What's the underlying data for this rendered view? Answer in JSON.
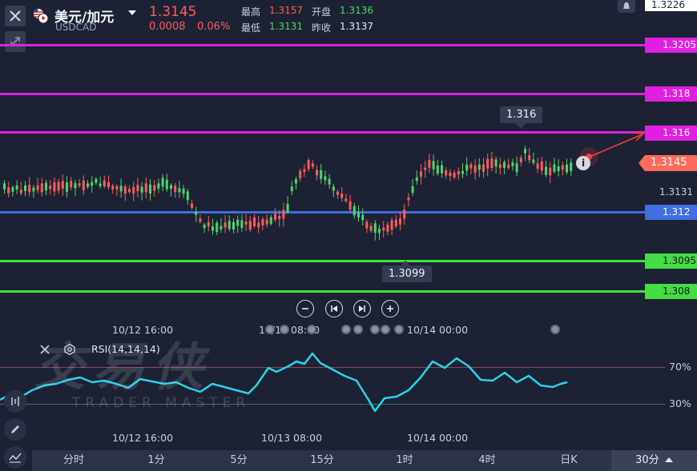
{
  "header": {
    "pair_title": "美元/加元",
    "symbol": "USDCAD",
    "last_price": "1.3145",
    "change": "0.0008",
    "change_pct": "0.06%",
    "stats": [
      {
        "label": "最高",
        "value": "1.3157",
        "color": "red"
      },
      {
        "label": "开盘",
        "value": "1.3136",
        "color": "green"
      },
      {
        "label": "最低",
        "value": "1.3131",
        "color": "green"
      },
      {
        "label": "昨收",
        "value": "1.3137",
        "color": "white"
      }
    ]
  },
  "price_axis": {
    "top_value": "1.3226",
    "lines": [
      {
        "value": "1.3205",
        "color": "#e020e0"
      },
      {
        "value": "1.318",
        "color": "#e020e0"
      },
      {
        "value": "1.316",
        "color": "#e020e0"
      },
      {
        "value": "1.312",
        "color": "#3f6fe0"
      },
      {
        "value": "1.3095",
        "color": "#44dd44"
      },
      {
        "value": "1.308",
        "color": "#44dd44"
      }
    ],
    "current_tag": "1.3145",
    "current_tag_color": "#ff6b5a",
    "low_label": "1.3131"
  },
  "chart_annotations": {
    "high_bubble": "1.316",
    "low_bubble": "1.3099"
  },
  "time_labels_top": [
    "10/12 16:00",
    "10/13 08:00",
    "10/14 00:00"
  ],
  "time_labels_bottom": [
    "10/12 16:00",
    "10/13 08:00",
    "10/14 00:00"
  ],
  "rsi": {
    "label": "RSI(14,14,14)",
    "upper": "70%",
    "lower": "30%",
    "line_color": "#2ad4e8"
  },
  "watermark": {
    "cn": "交易侠",
    "en": "TRADER MASTER"
  },
  "timeframe_tabs": [
    "分时",
    "1分",
    "5分",
    "15分",
    "1时",
    "4时",
    "日K",
    "30分"
  ],
  "selected_tab": "30分",
  "colors": {
    "up": "#4fd46c",
    "down": "#ff5d5d",
    "background": "#1c2233"
  }
}
